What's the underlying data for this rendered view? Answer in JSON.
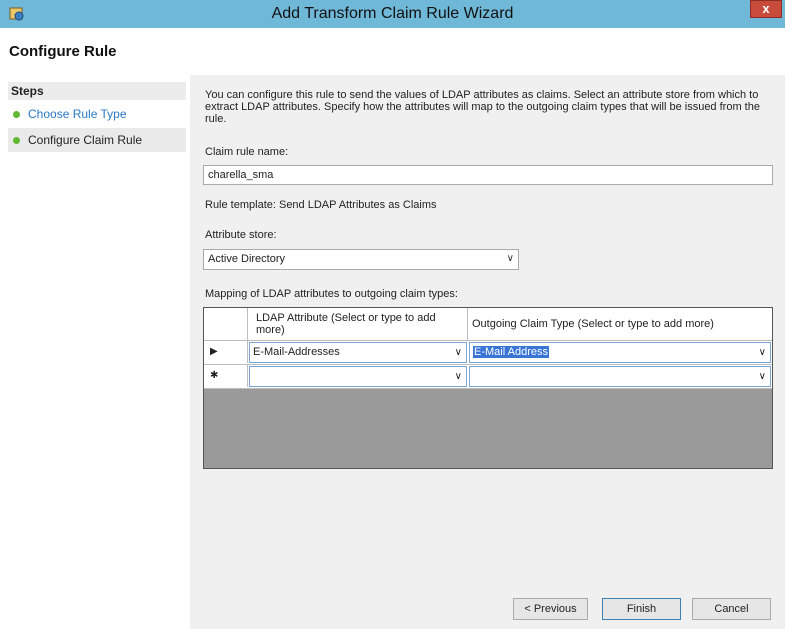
{
  "window": {
    "title": "Add Transform Claim Rule Wizard",
    "close_glyph": "x"
  },
  "page_heading": "Configure Rule",
  "steps": {
    "header": "Steps",
    "items": [
      {
        "label": "Choose Rule Type"
      },
      {
        "label": "Configure Claim Rule"
      }
    ]
  },
  "description": "You can configure this rule to send the values of LDAP attributes as claims. Select an attribute store from which to extract LDAP attributes. Specify how the attributes will map to the outgoing claim types that will be issued from the rule.",
  "claim_rule_name": {
    "label": "Claim rule name:",
    "value": "charella_sma"
  },
  "rule_template": "Rule template: Send LDAP Attributes as Claims",
  "attribute_store": {
    "label": "Attribute store:",
    "value": "Active Directory"
  },
  "mapping": {
    "label": "Mapping of LDAP attributes to outgoing claim types:",
    "col_ldap": "LDAP Attribute (Select or type to add more)",
    "col_claim": "Outgoing Claim Type (Select or type to add more)",
    "rows": [
      {
        "marker": "▶",
        "ldap": "E-Mail-Addresses",
        "claim": "E-Mail Address"
      },
      {
        "marker": "✱",
        "ldap": "",
        "claim": ""
      }
    ]
  },
  "buttons": {
    "previous": "< Previous",
    "finish": "Finish",
    "cancel": "Cancel"
  },
  "colors": {
    "titlebar": "#6fb8d8",
    "step_dot": "#5fb930",
    "link": "#2a78c8",
    "selection": "#3875d7"
  }
}
